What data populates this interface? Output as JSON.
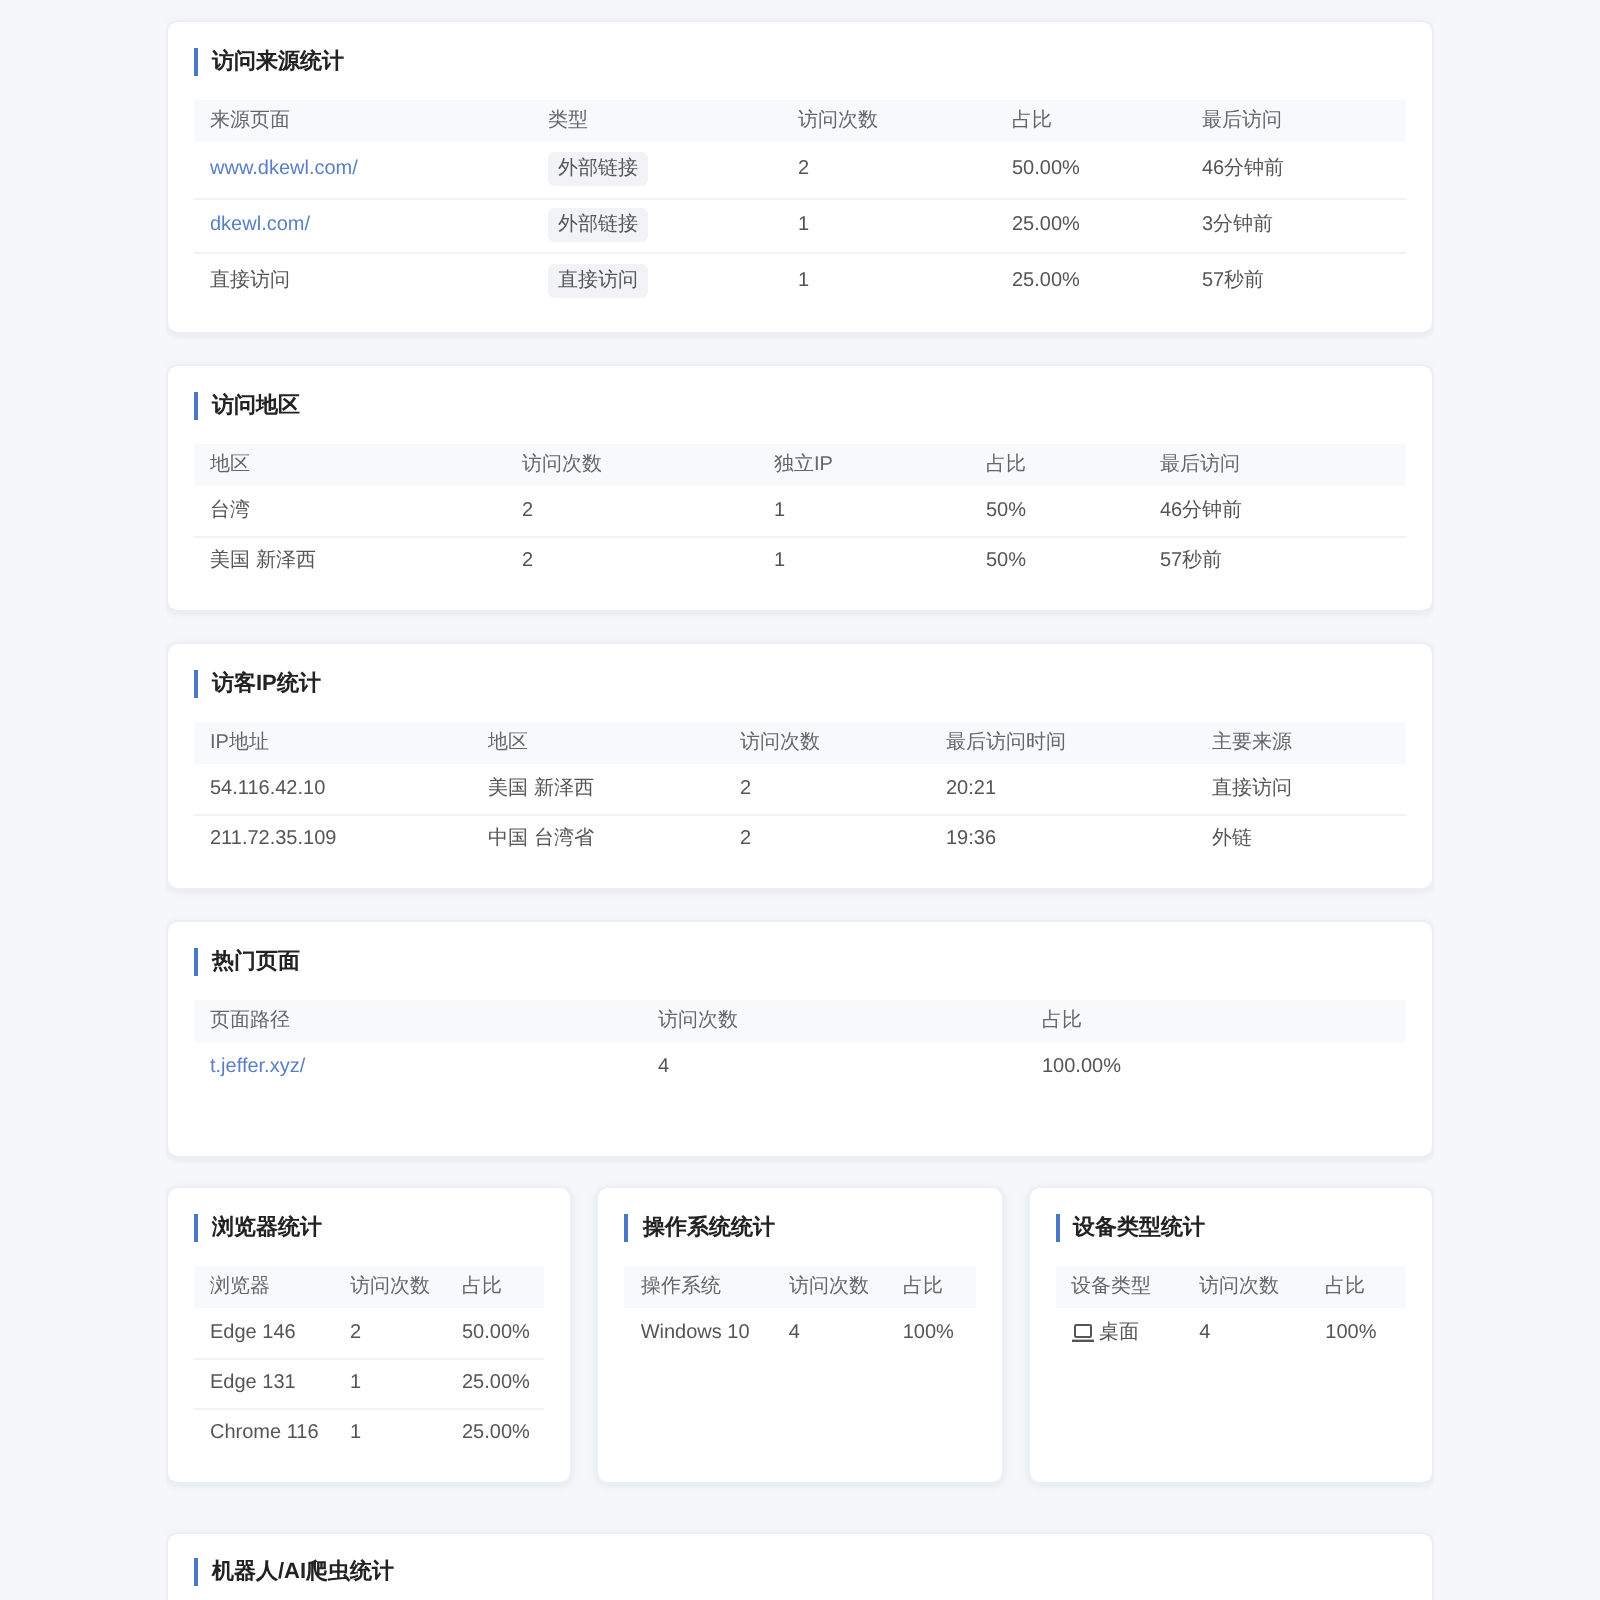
{
  "sections": [
    {
      "title": "访问来源统计",
      "columns": [
        "来源页面",
        "类型",
        "访问次数",
        "占比",
        "最后访问"
      ],
      "rows": [
        [
          {
            "kind": "link",
            "text": "www.dkewl.com/"
          },
          {
            "kind": "tag",
            "text": "外部链接"
          },
          {
            "kind": "text",
            "text": "2"
          },
          {
            "kind": "text",
            "text": "50.00%"
          },
          {
            "kind": "text",
            "text": "46分钟前"
          }
        ],
        [
          {
            "kind": "link",
            "text": "dkewl.com/"
          },
          {
            "kind": "tag",
            "text": "外部链接"
          },
          {
            "kind": "text",
            "text": "1"
          },
          {
            "kind": "text",
            "text": "25.00%"
          },
          {
            "kind": "text",
            "text": "3分钟前"
          }
        ],
        [
          {
            "kind": "text",
            "text": "直接访问"
          },
          {
            "kind": "tag",
            "text": "直接访问"
          },
          {
            "kind": "text",
            "text": "1"
          },
          {
            "kind": "text",
            "text": "25.00%"
          },
          {
            "kind": "text",
            "text": "57秒前"
          }
        ]
      ]
    },
    {
      "title": "访问地区",
      "columns": [
        "地区",
        "访问次数",
        "独立IP",
        "占比",
        "最后访问"
      ],
      "rows": [
        [
          {
            "kind": "text",
            "text": "台湾"
          },
          {
            "kind": "text",
            "text": "2"
          },
          {
            "kind": "text",
            "text": "1"
          },
          {
            "kind": "text",
            "text": "50%"
          },
          {
            "kind": "text",
            "text": "46分钟前"
          }
        ],
        [
          {
            "kind": "text",
            "text": "美国 新泽西"
          },
          {
            "kind": "text",
            "text": "2"
          },
          {
            "kind": "text",
            "text": "1"
          },
          {
            "kind": "text",
            "text": "50%"
          },
          {
            "kind": "text",
            "text": "57秒前"
          }
        ]
      ]
    },
    {
      "title": "访客IP统计",
      "columns": [
        "IP地址",
        "地区",
        "访问次数",
        "最后访问时间",
        "主要来源"
      ],
      "rows": [
        [
          {
            "kind": "text",
            "text": "54.116.42.10"
          },
          {
            "kind": "text",
            "text": "美国 新泽西"
          },
          {
            "kind": "text",
            "text": "2"
          },
          {
            "kind": "text",
            "text": "20:21"
          },
          {
            "kind": "text",
            "text": "直接访问"
          }
        ],
        [
          {
            "kind": "text",
            "text": "211.72.35.109"
          },
          {
            "kind": "text",
            "text": "中国 台湾省"
          },
          {
            "kind": "text",
            "text": "2"
          },
          {
            "kind": "text",
            "text": "19:36"
          },
          {
            "kind": "text",
            "text": "外链"
          }
        ]
      ]
    },
    {
      "title": "热门页面",
      "columns": [
        "页面路径",
        "访问次数",
        "占比"
      ],
      "rows": [
        [
          {
            "kind": "link",
            "text": "t.jeffer.xyz/"
          },
          {
            "kind": "text",
            "text": "4"
          },
          {
            "kind": "text",
            "text": "100.00%"
          }
        ]
      ]
    }
  ],
  "panels": [
    {
      "title": "浏览器统计",
      "columns": [
        "浏览器",
        "访问次数",
        "占比"
      ],
      "rows": [
        [
          {
            "kind": "text",
            "text": "Edge 146"
          },
          {
            "kind": "text",
            "text": "2"
          },
          {
            "kind": "text",
            "text": "50.00%"
          }
        ],
        [
          {
            "kind": "text",
            "text": "Edge 131"
          },
          {
            "kind": "text",
            "text": "1"
          },
          {
            "kind": "text",
            "text": "25.00%"
          }
        ],
        [
          {
            "kind": "text",
            "text": "Chrome 116"
          },
          {
            "kind": "text",
            "text": "1"
          },
          {
            "kind": "text",
            "text": "25.00%"
          }
        ]
      ]
    },
    {
      "title": "操作系统统计",
      "columns": [
        "操作系统",
        "访问次数",
        "占比"
      ],
      "rows": [
        [
          {
            "kind": "text",
            "text": "Windows 10"
          },
          {
            "kind": "text",
            "text": "4"
          },
          {
            "kind": "text",
            "text": "100%"
          }
        ]
      ]
    },
    {
      "title": "设备类型统计",
      "columns": [
        "设备类型",
        "访问次数",
        "占比"
      ],
      "rows": [
        [
          {
            "kind": "device",
            "text": "桌面"
          },
          {
            "kind": "text",
            "text": "4"
          },
          {
            "kind": "text",
            "text": "100%"
          }
        ]
      ]
    }
  ],
  "bottom_section": {
    "title": "机器人/AI爬虫统计"
  }
}
